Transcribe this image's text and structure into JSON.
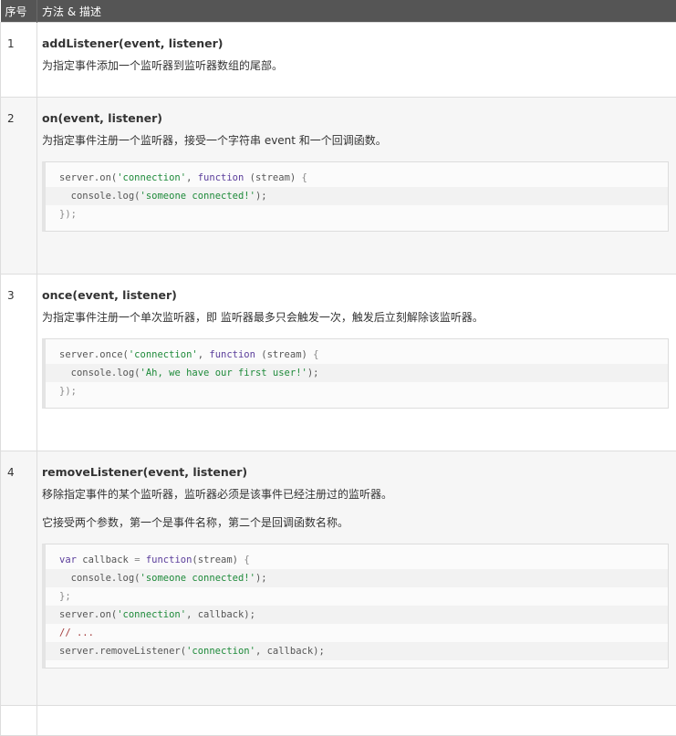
{
  "header": {
    "col_index": "序号",
    "col_method": "方法 & 描述"
  },
  "rows": [
    {
      "index": "1",
      "title": "addListener(event, listener)",
      "lines": [
        "为指定事件添加一个监听器到监听器数组的尾部。"
      ],
      "code": []
    },
    {
      "index": "2",
      "title": "on(event, listener)",
      "lines": [
        "为指定事件注册一个监听器，接受一个字符串 event 和一个回调函数。"
      ],
      "code": [
        [
          [
            "pl",
            "server.on("
          ],
          [
            "str",
            "'connection'"
          ],
          [
            "pl",
            ", "
          ],
          [
            "kw",
            "function"
          ],
          [
            "pl",
            " (stream) "
          ],
          [
            "pun",
            "{"
          ]
        ],
        [
          [
            "pl",
            "  console.log("
          ],
          [
            "str",
            "'someone connected!'"
          ],
          [
            "pl",
            ");"
          ]
        ],
        [
          [
            "pun",
            "});"
          ]
        ]
      ]
    },
    {
      "index": "3",
      "title": "once(event, listener)",
      "lines": [
        "为指定事件注册一个单次监听器，即 监听器最多只会触发一次，触发后立刻解除该监听器。"
      ],
      "code": [
        [
          [
            "pl",
            "server.once("
          ],
          [
            "str",
            "'connection'"
          ],
          [
            "pl",
            ", "
          ],
          [
            "kw",
            "function"
          ],
          [
            "pl",
            " (stream) "
          ],
          [
            "pun",
            "{"
          ]
        ],
        [
          [
            "pl",
            "  console.log("
          ],
          [
            "str",
            "'Ah, we have our first user!'"
          ],
          [
            "pl",
            ");"
          ]
        ],
        [
          [
            "pun",
            "});"
          ]
        ]
      ]
    },
    {
      "index": "4",
      "title": "removeListener(event, listener)",
      "lines": [
        "移除指定事件的某个监听器，监听器必须是该事件已经注册过的监听器。",
        "它接受两个参数，第一个是事件名称，第二个是回调函数名称。"
      ],
      "code": [
        [
          [
            "kw",
            "var"
          ],
          [
            "pl",
            " callback "
          ],
          [
            "pun",
            "="
          ],
          [
            "pl",
            " "
          ],
          [
            "kw",
            "function"
          ],
          [
            "pl",
            "(stream) "
          ],
          [
            "pun",
            "{"
          ]
        ],
        [
          [
            "pl",
            "  console.log("
          ],
          [
            "str",
            "'someone connected!'"
          ],
          [
            "pl",
            ");"
          ]
        ],
        [
          [
            "pun",
            "};"
          ]
        ],
        [
          [
            "pl",
            "server.on("
          ],
          [
            "str",
            "'connection'"
          ],
          [
            "pl",
            ", callback);"
          ]
        ],
        [
          [
            "com",
            "// ..."
          ]
        ],
        [
          [
            "pl",
            "server.removeListener("
          ],
          [
            "str",
            "'connection'"
          ],
          [
            "pl",
            ", callback);"
          ]
        ]
      ]
    }
  ],
  "colors": {
    "header_bg": "#555555",
    "row_alt_bg": "#f6f6f6",
    "code_keyword": "#5b3e9b",
    "code_string": "#1e8a3a",
    "code_comment": "#a33a3a"
  }
}
